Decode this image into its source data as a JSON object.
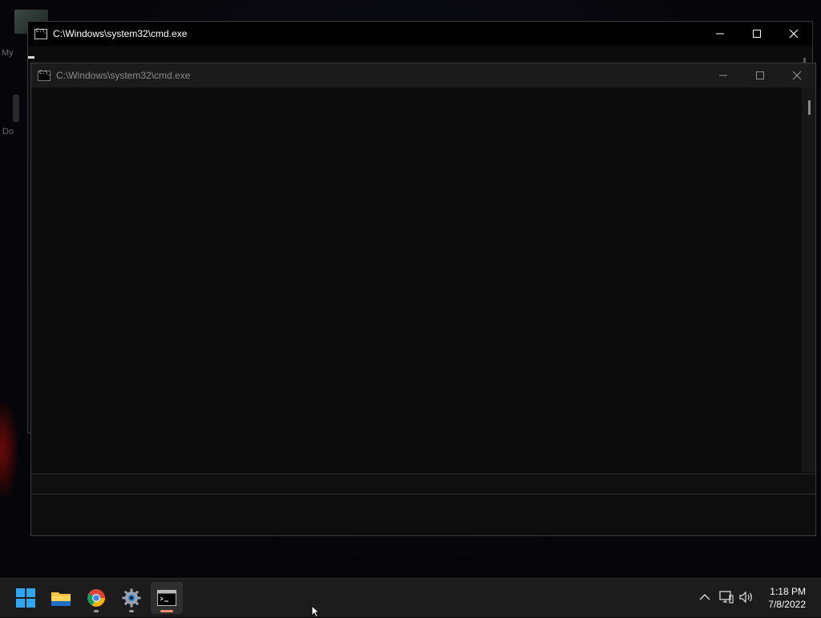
{
  "desktop": {
    "icons": [
      {
        "label": "My"
      },
      {
        "label": "Do"
      }
    ]
  },
  "windows": {
    "back": {
      "title": "C:\\Windows\\system32\\cmd.exe"
    },
    "front": {
      "title": "C:\\Windows\\system32\\cmd.exe"
    }
  },
  "taskbar": {
    "apps": [
      {
        "name": "start-button"
      },
      {
        "name": "file-explorer"
      },
      {
        "name": "chrome"
      },
      {
        "name": "settings"
      },
      {
        "name": "command-prompt",
        "active": true
      }
    ]
  },
  "tray": {
    "time": "1:18 PM",
    "date": "7/8/2022"
  }
}
